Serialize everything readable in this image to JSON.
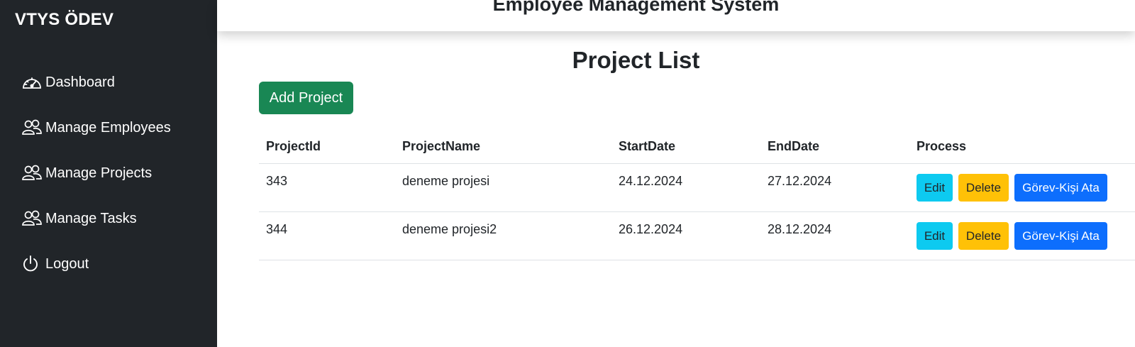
{
  "sidebar": {
    "brand": "VTYS ÖDEV",
    "items": [
      {
        "label": "Dashboard",
        "icon": "speedometer-icon"
      },
      {
        "label": "Manage Employees",
        "icon": "people-icon"
      },
      {
        "label": "Manage Projects",
        "icon": "people-icon"
      },
      {
        "label": "Manage Tasks",
        "icon": "people-icon"
      },
      {
        "label": "Logout",
        "icon": "power-icon"
      }
    ]
  },
  "header": {
    "title": "Employee Management System"
  },
  "main": {
    "title": "Project List",
    "add_button": "Add Project",
    "table": {
      "columns": [
        "ProjectId",
        "ProjectName",
        "StartDate",
        "EndDate",
        "Process"
      ],
      "rows": [
        {
          "id": "343",
          "name": "deneme projesi",
          "start": "24.12.2024",
          "end": "27.12.2024"
        },
        {
          "id": "344",
          "name": "deneme projesi2",
          "start": "26.12.2024",
          "end": "28.12.2024"
        }
      ],
      "actions": {
        "edit": "Edit",
        "delete": "Delete",
        "assign": "Görev-Kişi Ata"
      }
    }
  },
  "colors": {
    "sidebar_bg": "#212529",
    "success": "#198754",
    "info": "#0dcaf0",
    "warning": "#ffc107",
    "primary": "#0d6efd"
  }
}
